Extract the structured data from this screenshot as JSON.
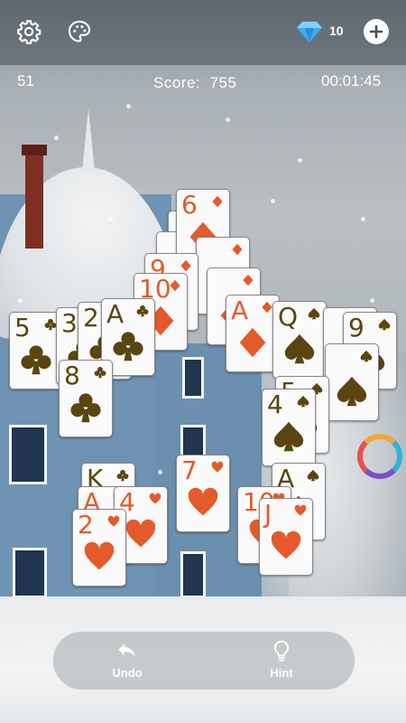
{
  "topbar": {
    "settings_icon": "gear-icon",
    "theme_icon": "palette-icon",
    "gem_icon": "diamond-icon",
    "gem_count": "10",
    "add_icon": "plus-icon"
  },
  "status": {
    "moves": "51",
    "score_label": "Score:",
    "score_value": "755",
    "timer": "00:01:45"
  },
  "board": {
    "cards": [
      {
        "rank": "",
        "suit": "diamond"
      },
      {
        "rank": "",
        "suit": "diamond"
      },
      {
        "rank": "6",
        "suit": "diamond"
      },
      {
        "rank": "",
        "suit": "diamond"
      },
      {
        "rank": "9",
        "suit": "diamond"
      },
      {
        "rank": "10",
        "suit": "diamond"
      },
      {
        "rank": "",
        "suit": "diamond"
      },
      {
        "rank": "A",
        "suit": "diamond"
      },
      {
        "rank": "Q",
        "suit": "spade"
      },
      {
        "rank": "",
        "suit": "spade"
      },
      {
        "rank": "5",
        "suit": "club"
      },
      {
        "rank": "3",
        "suit": "club"
      },
      {
        "rank": "2",
        "suit": "club"
      },
      {
        "rank": "A",
        "suit": "club"
      },
      {
        "rank": "8",
        "suit": "club"
      },
      {
        "rank": "9",
        "suit": "spade"
      },
      {
        "rank": "",
        "suit": "spade"
      },
      {
        "rank": "5",
        "suit": "spade"
      },
      {
        "rank": "4",
        "suit": "spade"
      },
      {
        "rank": "K",
        "suit": "club"
      },
      {
        "rank": "A",
        "suit": "heart"
      },
      {
        "rank": "4",
        "suit": "heart"
      },
      {
        "rank": "7",
        "suit": "heart"
      },
      {
        "rank": "A",
        "suit": "spade"
      },
      {
        "rank": "10",
        "suit": "heart"
      },
      {
        "rank": "J",
        "suit": "heart"
      },
      {
        "rank": "2",
        "suit": "heart"
      }
    ]
  },
  "bottom": {
    "undo_label": "Undo",
    "hint_label": "Hint"
  },
  "colors": {
    "red_suit": "#e45a2a",
    "black_suit": "#5a4510"
  }
}
